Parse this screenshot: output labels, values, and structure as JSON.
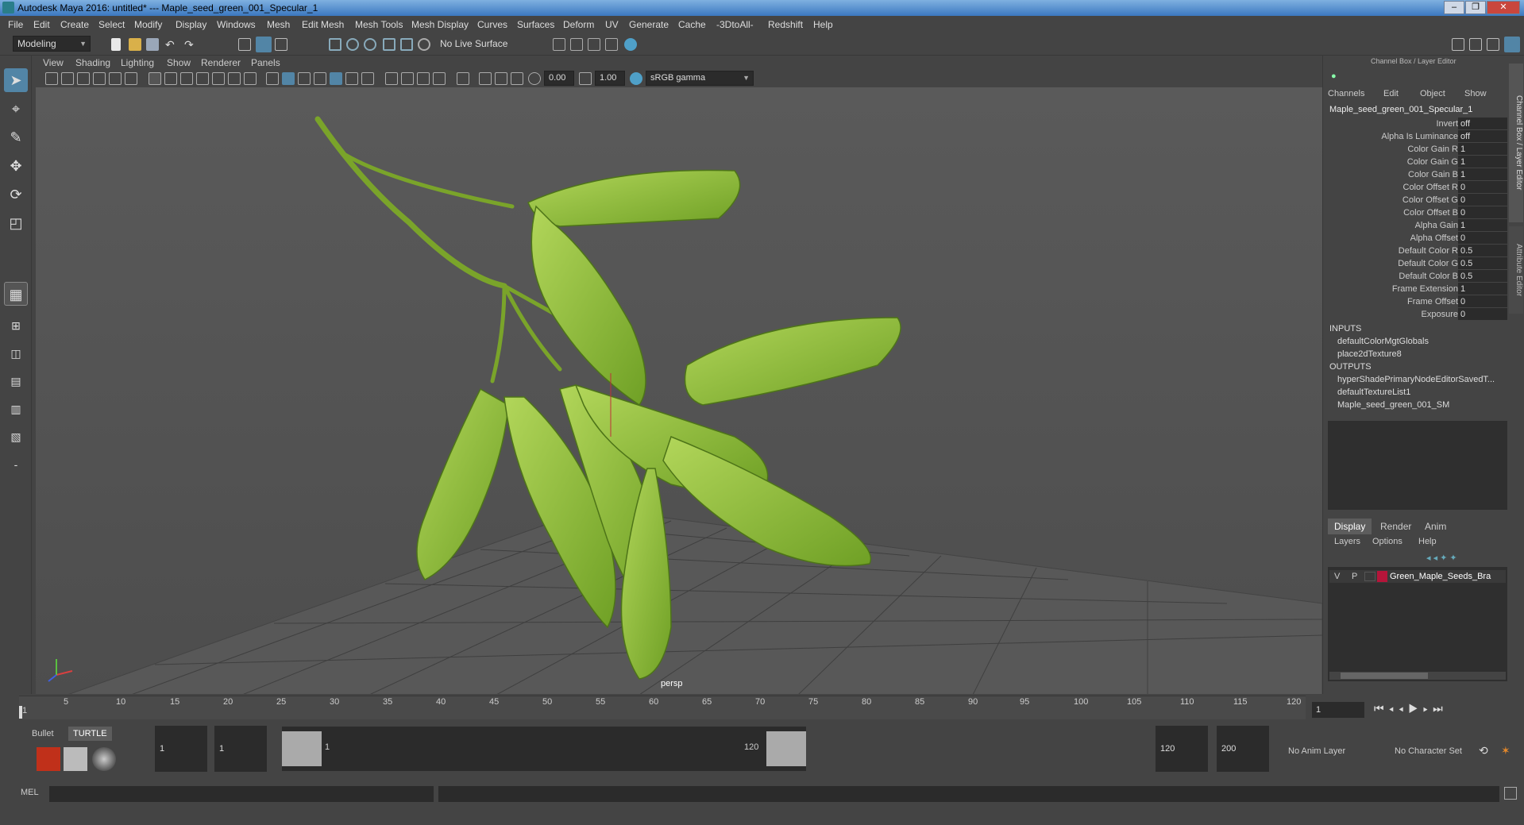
{
  "app": {
    "title": "Autodesk Maya 2016: untitled*   ---   Maple_seed_green_001_Specular_1"
  },
  "menus": [
    "File",
    "Edit",
    "Create",
    "Select",
    "Modify",
    "Display",
    "Windows",
    "Mesh",
    "Edit Mesh",
    "Mesh Tools",
    "Mesh Display",
    "Curves",
    "Surfaces",
    "Deform",
    "UV",
    "Generate",
    "Cache",
    "-3DtoAll-",
    "Redshift",
    "Help"
  ],
  "toolbar": {
    "mode": "Modeling",
    "live_surface": "No Live Surface"
  },
  "viewport": {
    "menus": [
      "View",
      "Shading",
      "Lighting",
      "Show",
      "Renderer",
      "Panels"
    ],
    "field1": "0.00",
    "field2": "1.00",
    "color_space": "sRGB gamma",
    "camera_label": "persp"
  },
  "channel_box": {
    "title": "Channel Box / Layer Editor",
    "menus": [
      "Channels",
      "Edit",
      "Object",
      "Show"
    ],
    "node": "Maple_seed_green_001_Specular_1",
    "attrs": [
      {
        "label": "Invert",
        "value": "off"
      },
      {
        "label": "Alpha Is Luminance",
        "value": "off"
      },
      {
        "label": "Color Gain R",
        "value": "1"
      },
      {
        "label": "Color Gain G",
        "value": "1"
      },
      {
        "label": "Color Gain B",
        "value": "1"
      },
      {
        "label": "Color Offset R",
        "value": "0"
      },
      {
        "label": "Color Offset G",
        "value": "0"
      },
      {
        "label": "Color Offset B",
        "value": "0"
      },
      {
        "label": "Alpha Gain",
        "value": "1"
      },
      {
        "label": "Alpha Offset",
        "value": "0"
      },
      {
        "label": "Default Color R",
        "value": "0.5"
      },
      {
        "label": "Default Color G",
        "value": "0.5"
      },
      {
        "label": "Default Color B",
        "value": "0.5"
      },
      {
        "label": "Frame Extension",
        "value": "1"
      },
      {
        "label": "Frame Offset",
        "value": "0"
      },
      {
        "label": "Exposure",
        "value": "0"
      }
    ],
    "inputs_label": "INPUTS",
    "inputs": [
      "defaultColorMgtGlobals",
      "place2dTexture8"
    ],
    "outputs_label": "OUTPUTS",
    "outputs": [
      "hyperShadePrimaryNodeEditorSavedT...",
      "defaultTextureList1",
      "Maple_seed_green_001_SM"
    ],
    "side_tabs": [
      "Channel Box / Layer Editor",
      "Attribute Editor"
    ]
  },
  "layer_editor": {
    "tabs": [
      "Display",
      "Render",
      "Anim"
    ],
    "menus": [
      "Layers",
      "Options",
      "Help"
    ],
    "layer": {
      "v": "V",
      "p": "P",
      "name": "Green_Maple_Seeds_Bra",
      "color": "#b5153a"
    }
  },
  "timeline": {
    "ticks": [
      "1",
      "5",
      "10",
      "15",
      "20",
      "25",
      "30",
      "35",
      "40",
      "45",
      "50",
      "55",
      "60",
      "65",
      "70",
      "75",
      "80",
      "85",
      "90",
      "95",
      "100",
      "105",
      "110",
      "115",
      "120"
    ],
    "current_frame": "1"
  },
  "range": {
    "shelf_tabs": [
      "Bullet",
      "TURTLE"
    ],
    "start": "1",
    "playback_start": "1",
    "slider_start": "1",
    "slider_end": "120",
    "playback_end": "120",
    "end": "200",
    "anim_layer": "No Anim Layer",
    "char_set": "No Character Set"
  },
  "command_line": {
    "label": "MEL"
  }
}
